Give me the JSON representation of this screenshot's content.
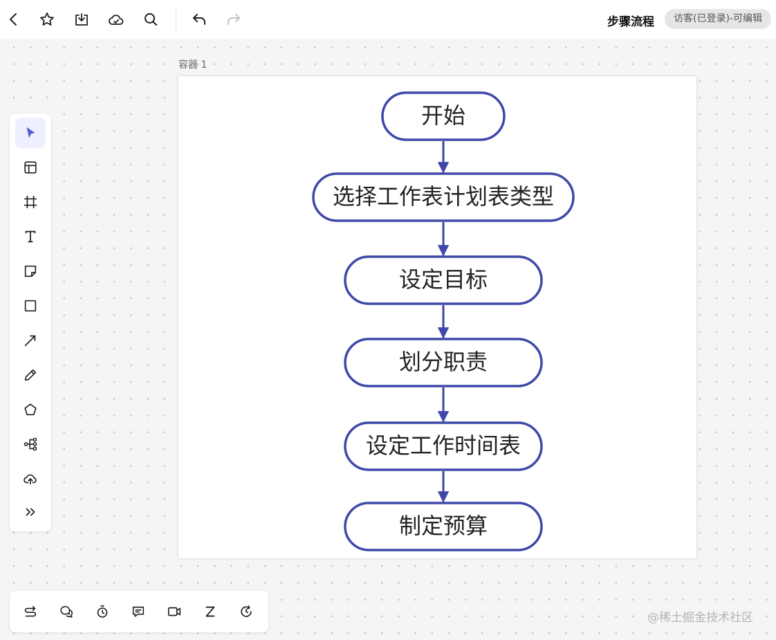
{
  "header": {
    "title": "步骤流程",
    "access_badge": "访客(已登录)-可编辑",
    "buttons": [
      {
        "name": "back-button",
        "icon": "chevron-left-icon"
      },
      {
        "name": "favorite-button",
        "icon": "star-icon"
      },
      {
        "name": "download-button",
        "icon": "download-icon"
      },
      {
        "name": "cloud-save-button",
        "icon": "cloud-icon"
      },
      {
        "name": "search-button",
        "icon": "search-icon"
      },
      {
        "name": "undo-button",
        "icon": "undo-icon"
      },
      {
        "name": "redo-button",
        "icon": "redo-icon"
      }
    ]
  },
  "left_toolbar": {
    "tools": [
      {
        "name": "select-tool",
        "icon": "cursor-arrow-icon",
        "active": true
      },
      {
        "name": "template-tool",
        "icon": "layout-icon"
      },
      {
        "name": "frame-tool",
        "icon": "frame-icon"
      },
      {
        "name": "text-tool",
        "icon": "text-icon"
      },
      {
        "name": "sticky-note-tool",
        "icon": "sticky-note-icon"
      },
      {
        "name": "rectangle-tool",
        "icon": "square-icon"
      },
      {
        "name": "connector-tool",
        "icon": "arrow-icon"
      },
      {
        "name": "pen-tool",
        "icon": "pencil-icon"
      },
      {
        "name": "shape-tool",
        "icon": "pentagon-icon"
      },
      {
        "name": "mindmap-tool",
        "icon": "mindmap-icon"
      },
      {
        "name": "upload-tool",
        "icon": "cloud-upload-icon"
      },
      {
        "name": "more-tools",
        "icon": "double-chevron-right-icon"
      }
    ]
  },
  "bottom_toolbar": {
    "tools": [
      {
        "name": "switch-tool",
        "icon": "switch-icon"
      },
      {
        "name": "chat-tool",
        "icon": "chat-bubbles-icon"
      },
      {
        "name": "timer-tool",
        "icon": "timer-icon"
      },
      {
        "name": "comment-tool",
        "icon": "comment-icon"
      },
      {
        "name": "video-tool",
        "icon": "video-icon"
      },
      {
        "name": "sleep-tool",
        "icon": "z-icon"
      },
      {
        "name": "history-tool",
        "icon": "history-icon"
      }
    ]
  },
  "canvas": {
    "container_label": "容器 1",
    "flowchart": {
      "nodes": [
        {
          "id": "n1",
          "label": "开始"
        },
        {
          "id": "n2",
          "label": "选择工作表计划表类型"
        },
        {
          "id": "n3",
          "label": "设定目标"
        },
        {
          "id": "n4",
          "label": "划分职责"
        },
        {
          "id": "n5",
          "label": "设定工作时间表"
        },
        {
          "id": "n6",
          "label": "制定预算"
        }
      ],
      "edges": [
        [
          "n1",
          "n2"
        ],
        [
          "n2",
          "n3"
        ],
        [
          "n3",
          "n4"
        ],
        [
          "n4",
          "n5"
        ],
        [
          "n5",
          "n6"
        ]
      ],
      "stroke_color": "#3f48a8"
    }
  },
  "watermark": "@稀土掘金技术社区",
  "colors": {
    "accent": "#4f5bd5",
    "node_border": "#3f48a8",
    "icon": "#1f1f1f",
    "icon_disabled": "#c4c4c4"
  }
}
